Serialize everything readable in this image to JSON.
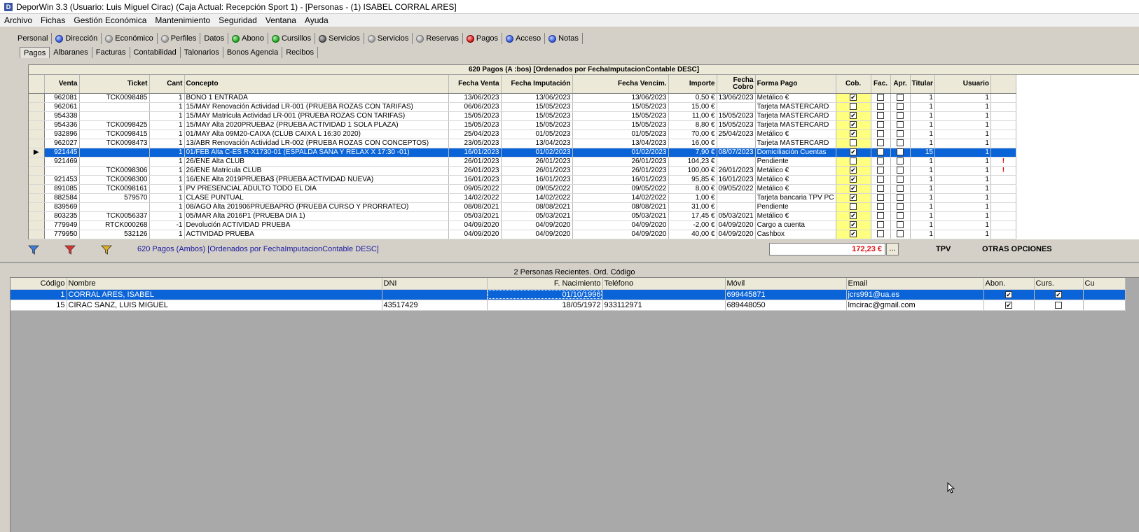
{
  "window": {
    "title": "DeporWin 3.3  (Usuario: Luis Miguel Cirac)  (Caja Actual: Recepción Sport 1) - [Personas - (1) ISABEL CORRAL ARES]",
    "icon_letter": "D"
  },
  "menu": [
    "Archivo",
    "Fichas",
    "Gestión Económica",
    "Mantenimiento",
    "Seguridad",
    "Ventana",
    "Ayuda"
  ],
  "tabs_main": [
    {
      "label": "Personal",
      "dot": ""
    },
    {
      "label": "Dirección",
      "dot": "blue"
    },
    {
      "label": "Económico",
      "dot": "gray"
    },
    {
      "label": "Perfiles",
      "dot": "gray"
    },
    {
      "label": "Datos",
      "dot": ""
    },
    {
      "label": "Abono",
      "dot": "green"
    },
    {
      "label": "Cursillos",
      "dot": "green"
    },
    {
      "label": "Servicios",
      "dot": "darkgray"
    },
    {
      "label": "Servicios",
      "dot": "gray"
    },
    {
      "label": "Reservas",
      "dot": "gray"
    },
    {
      "label": "Pagos",
      "dot": "red"
    },
    {
      "label": "Acceso",
      "dot": "blue"
    },
    {
      "label": "Notas",
      "dot": "blue"
    }
  ],
  "tabs_sub": [
    "Pagos",
    "Albaranes",
    "Facturas",
    "Contabilidad",
    "Talonarios",
    "Bonos Agencia",
    "Recibos"
  ],
  "pagos": {
    "caption": "620 Pagos (A :bos) [Ordenados por FechaImputacionContable DESC]",
    "headers": [
      "Venta",
      "Ticket",
      "Cant",
      "Concepto",
      "Fecha Venta",
      "Fecha Imputación",
      "Fecha Vencim.",
      "Importe",
      "Fecha Cobro",
      "Forma Pago",
      "Cob.",
      "Fac.",
      "Apr.",
      "Titular",
      "Usuario"
    ],
    "rows": [
      {
        "venta": "962081",
        "ticket": "TCK0098485",
        "cant": "1",
        "concepto": "BONO 1 ENTRADA",
        "fventa": "13/06/2023",
        "fimput": "13/06/2023",
        "fvenc": "13/06/2023",
        "importe": "0,50 €",
        "fcobro": "13/06/2023",
        "forma": "Metálico €",
        "cob": true,
        "fac": false,
        "apr": false,
        "titular": "1",
        "usuario": "1",
        "mark": ""
      },
      {
        "venta": "962061",
        "ticket": "",
        "cant": "1",
        "concepto": "15/MAY Renovación Actividad LR-001 (PRUEBA ROZAS CON TARIFAS)",
        "fventa": "06/06/2023",
        "fimput": "15/05/2023",
        "fvenc": "15/05/2023",
        "importe": "15,00 €",
        "fcobro": "",
        "forma": "Tarjeta MASTERCARD",
        "cob": false,
        "fac": false,
        "apr": false,
        "titular": "1",
        "usuario": "1",
        "mark": ""
      },
      {
        "venta": "954338",
        "ticket": "",
        "cant": "1",
        "concepto": "15/MAY Matrícula Actividad LR-001 (PRUEBA ROZAS CON TARIFAS)",
        "fventa": "15/05/2023",
        "fimput": "15/05/2023",
        "fvenc": "15/05/2023",
        "importe": "11,00 €",
        "fcobro": "15/05/2023",
        "forma": "Tarjeta MASTERCARD",
        "cob": true,
        "fac": false,
        "apr": false,
        "titular": "1",
        "usuario": "1",
        "mark": ""
      },
      {
        "venta": "954336",
        "ticket": "TCK0098425",
        "cant": "1",
        "concepto": "15/MAY Alta 2020PRUEBA2 (PRUEBA ACTIVIDAD 1 SOLA PLAZA)",
        "fventa": "15/05/2023",
        "fimput": "15/05/2023",
        "fvenc": "15/05/2023",
        "importe": "8,80 €",
        "fcobro": "15/05/2023",
        "forma": "Tarjeta MASTERCARD",
        "cob": true,
        "fac": false,
        "apr": false,
        "titular": "1",
        "usuario": "1",
        "mark": ""
      },
      {
        "venta": "932896",
        "ticket": "TCK0098415",
        "cant": "1",
        "concepto": "01/MAY Alta 09M20-CAIXA (CLUB CAIXA L 16:30 2020)",
        "fventa": "25/04/2023",
        "fimput": "01/05/2023",
        "fvenc": "01/05/2023",
        "importe": "70,00 €",
        "fcobro": "25/04/2023",
        "forma": "Metálico €",
        "cob": true,
        "fac": false,
        "apr": false,
        "titular": "1",
        "usuario": "1",
        "mark": ""
      },
      {
        "venta": "962027",
        "ticket": "TCK0098473",
        "cant": "1",
        "concepto": "13/ABR Renovación Actividad LR-002 (PRUEBA ROZAS CON CONCEPTOS)",
        "fventa": "23/05/2023",
        "fimput": "13/04/2023",
        "fvenc": "13/04/2023",
        "importe": "16,00 €",
        "fcobro": "",
        "forma": "Tarjeta MASTERCARD",
        "cob": false,
        "fac": false,
        "apr": false,
        "titular": "1",
        "usuario": "1",
        "mark": ""
      },
      {
        "venta": "921445",
        "ticket": "",
        "cant": "1",
        "concepto": "01/FEB Alta C-ES R-X1730-01 (ESPALDA SANA Y RELAX X 17:30 -01)",
        "fventa": "16/01/2023",
        "fimput": "01/02/2023",
        "fvenc": "01/02/2023",
        "importe": "7,90 €",
        "fcobro": "08/07/2023",
        "forma": "Domiciliación Cuentas",
        "cob": true,
        "fac": false,
        "apr": false,
        "titular": "15",
        "usuario": "1",
        "mark": "",
        "selected": true
      },
      {
        "venta": "921469",
        "ticket": "",
        "cant": "1",
        "concepto": "26/ENE Alta CLUB",
        "fventa": "26/01/2023",
        "fimput": "26/01/2023",
        "fvenc": "26/01/2023",
        "importe": "104,23 €",
        "fcobro": "",
        "forma": "Pendiente",
        "cob": false,
        "fac": false,
        "apr": false,
        "titular": "1",
        "usuario": "1",
        "mark": "!"
      },
      {
        "venta": "",
        "ticket": "TCK0098306",
        "cant": "1",
        "concepto": "26/ENE Matrícula CLUB",
        "fventa": "26/01/2023",
        "fimput": "26/01/2023",
        "fvenc": "26/01/2023",
        "importe": "100,00 €",
        "fcobro": "26/01/2023",
        "forma": "Metálico €",
        "cob": true,
        "fac": false,
        "apr": false,
        "titular": "1",
        "usuario": "1",
        "mark": "!"
      },
      {
        "venta": "921453",
        "ticket": "TCK0098300",
        "cant": "1",
        "concepto": "16/ENE Alta 2019PRUEBA$ (PRUEBA ACTIVIDAD NUEVA)",
        "fventa": "16/01/2023",
        "fimput": "16/01/2023",
        "fvenc": "16/01/2023",
        "importe": "95,85 €",
        "fcobro": "16/01/2023",
        "forma": "Metálico €",
        "cob": true,
        "fac": false,
        "apr": false,
        "titular": "1",
        "usuario": "1",
        "mark": ""
      },
      {
        "venta": "891085",
        "ticket": "TCK0098161",
        "cant": "1",
        "concepto": "PV PRESENCIAL ADULTO TODO EL DIA",
        "fventa": "09/05/2022",
        "fimput": "09/05/2022",
        "fvenc": "09/05/2022",
        "importe": "8,00 €",
        "fcobro": "09/05/2022",
        "forma": "Metálico €",
        "cob": true,
        "fac": false,
        "apr": false,
        "titular": "1",
        "usuario": "1",
        "mark": ""
      },
      {
        "venta": "882584",
        "ticket": "579570",
        "cant": "1",
        "concepto": "CLASE PUNTUAL",
        "fventa": "14/02/2022",
        "fimput": "14/02/2022",
        "fvenc": "14/02/2022",
        "importe": "1,00 €",
        "fcobro": "",
        "forma": "Tarjeta bancaria TPV PC",
        "cob": true,
        "fac": false,
        "apr": false,
        "titular": "1",
        "usuario": "1",
        "mark": ""
      },
      {
        "venta": "839569",
        "ticket": "",
        "cant": "1",
        "concepto": "08/AGO Alta 201906PRUEBAPRO (PRUEBA CURSO Y PRORRATEO)",
        "fventa": "08/08/2021",
        "fimput": "08/08/2021",
        "fvenc": "08/08/2021",
        "importe": "31,00 €",
        "fcobro": "",
        "forma": "Pendiente",
        "cob": false,
        "fac": false,
        "apr": false,
        "titular": "1",
        "usuario": "1",
        "mark": ""
      },
      {
        "venta": "803235",
        "ticket": "TCK0056337",
        "cant": "1",
        "concepto": "05/MAR Alta 2016P1 (PRUEBA DIA 1)",
        "fventa": "05/03/2021",
        "fimput": "05/03/2021",
        "fvenc": "05/03/2021",
        "importe": "17,45 €",
        "fcobro": "05/03/2021",
        "forma": "Metálico €",
        "cob": true,
        "fac": false,
        "apr": false,
        "titular": "1",
        "usuario": "1",
        "mark": ""
      },
      {
        "venta": "779949",
        "ticket": "RTCK000268",
        "cant": "-1",
        "concepto": "Devolución ACTIVIDAD PRUEBA",
        "fventa": "04/09/2020",
        "fimput": "04/09/2020",
        "fvenc": "04/09/2020",
        "importe": "-2,00 €",
        "fcobro": "04/09/2020",
        "forma": "Cargo a cuenta",
        "cob": true,
        "fac": false,
        "apr": false,
        "titular": "1",
        "usuario": "1",
        "mark": ""
      },
      {
        "venta": "779950",
        "ticket": "532126",
        "cant": "1",
        "concepto": "ACTIVIDAD PRUEBA",
        "fventa": "04/09/2020",
        "fimput": "04/09/2020",
        "fvenc": "04/09/2020",
        "importe": "40,00 €",
        "fcobro": "04/09/2020",
        "forma": "Cashbox",
        "cob": true,
        "fac": false,
        "apr": false,
        "titular": "1",
        "usuario": "1",
        "mark": ""
      }
    ]
  },
  "filter_bar": {
    "text": "620 Pagos (Ambos) [Ordenados por FechaImputacionContable DESC]",
    "total": "172,23 €",
    "dots": "...",
    "tpv": "TPV",
    "otras": "OTRAS OPCIONES",
    "funnel_colors": [
      "#3a7ee0",
      "#e03030",
      "#e0b020"
    ]
  },
  "personas": {
    "caption": "2 Personas Recientes. Ord. Código",
    "headers": [
      "Código",
      "Nombre",
      "DNI",
      "F. Nacimiento",
      "Teléfono",
      "Móvil",
      "Email",
      "Abon.",
      "Curs.",
      "Cu"
    ],
    "rows": [
      {
        "codigo": "1",
        "nombre": "CORRAL ARES, ISABEL",
        "dni": "",
        "fnac": "01/10/1996",
        "telefono": "",
        "movil": "699445871",
        "email": "jcrs991@ua.es",
        "abon": true,
        "curs": true,
        "selected": true
      },
      {
        "codigo": "15",
        "nombre": "CIRAC SANZ, LUIS MIGUEL",
        "dni": "43517429",
        "fnac": "18/05/1972",
        "telefono": "933112971",
        "movil": "689448050",
        "email": "lmcirac@gmail.com",
        "abon": true,
        "curs": false
      }
    ]
  },
  "colors": {
    "selection": "#0a64d8",
    "cob_column": "#ffff80",
    "total_text": "#e01010"
  }
}
